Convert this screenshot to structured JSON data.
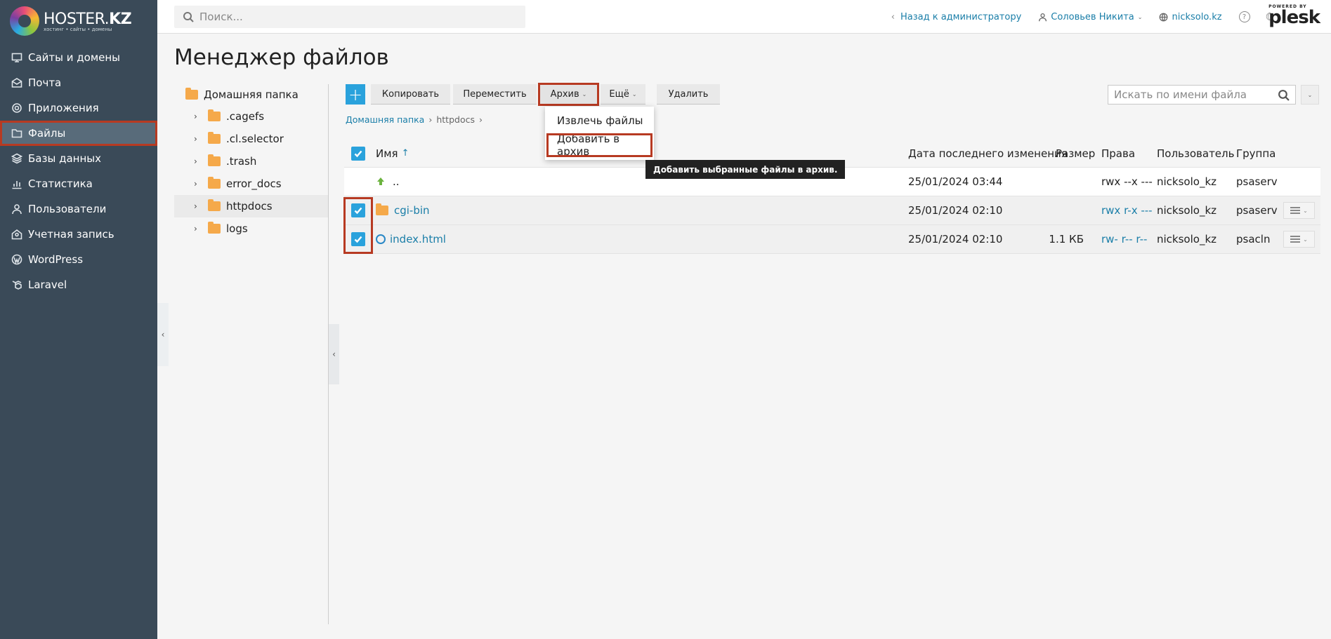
{
  "brand": {
    "title_thin": "HOSTER.",
    "title_bold": "KZ",
    "subtitle": "хостинг • сайты • домены"
  },
  "sidebar": {
    "items": [
      {
        "label": "Сайты и домены",
        "icon": "monitor-icon"
      },
      {
        "label": "Почта",
        "icon": "mail-icon"
      },
      {
        "label": "Приложения",
        "icon": "gear-icon"
      },
      {
        "label": "Файлы",
        "icon": "folder-icon",
        "active": true
      },
      {
        "label": "Базы данных",
        "icon": "layers-icon"
      },
      {
        "label": "Статистика",
        "icon": "chart-icon"
      },
      {
        "label": "Пользователи",
        "icon": "user-icon"
      },
      {
        "label": "Учетная запись",
        "icon": "account-icon"
      },
      {
        "label": "WordPress",
        "icon": "wordpress-icon"
      },
      {
        "label": "Laravel",
        "icon": "laravel-icon"
      }
    ]
  },
  "topbar": {
    "search_placeholder": "Поиск...",
    "back_link": "Назад к администратору",
    "user": "Соловьев Никита",
    "domain": "nicksolo.kz",
    "help": "?",
    "powered_by": "POWERED BY",
    "plesk": "plesk"
  },
  "page": {
    "title": "Менеджер файлов"
  },
  "tree": {
    "root": "Домашняя папка",
    "items": [
      ".cagefs",
      ".cl.selector",
      ".trash",
      "error_docs",
      "httpdocs",
      "logs"
    ],
    "selected": "httpdocs"
  },
  "toolbar": {
    "plus": "+",
    "copy": "Копировать",
    "move": "Переместить",
    "archive": "Архив",
    "more": "Ещё",
    "delete": "Удалить",
    "file_search_placeholder": "Искать по имени файла"
  },
  "archive_menu": {
    "extract": "Извлечь файлы",
    "add": "Добавить в архив",
    "tooltip": "Добавить выбранные файлы в архив."
  },
  "breadcrumb": {
    "home": "Домашняя папка",
    "current": "httpdocs"
  },
  "table": {
    "headers": {
      "name": "Имя",
      "sort": "↑",
      "modified": "Дата последнего изменения",
      "size": "Размер",
      "perms": "Права",
      "user": "Пользователь",
      "group": "Группа"
    },
    "rows": [
      {
        "name": "..",
        "modified": "25/01/2024 03:44",
        "size": "",
        "perms": "rwx --x ---",
        "user": "nicksolo_kz",
        "group": "psaserv"
      },
      {
        "name": "cgi-bin",
        "modified": "25/01/2024 02:10",
        "size": "",
        "perms": "rwx r-x ---",
        "user": "nicksolo_kz",
        "group": "psaserv"
      },
      {
        "name": "index.html",
        "modified": "25/01/2024 02:10",
        "size": "1.1 КБ",
        "perms": "rw- r-- r--",
        "user": "nicksolo_kz",
        "group": "psacln"
      }
    ]
  },
  "colors": {
    "sidebar_bg": "#3a4a58",
    "accent": "#2aa2dc",
    "highlight": "#b73a22",
    "link": "#1a7ea8"
  }
}
